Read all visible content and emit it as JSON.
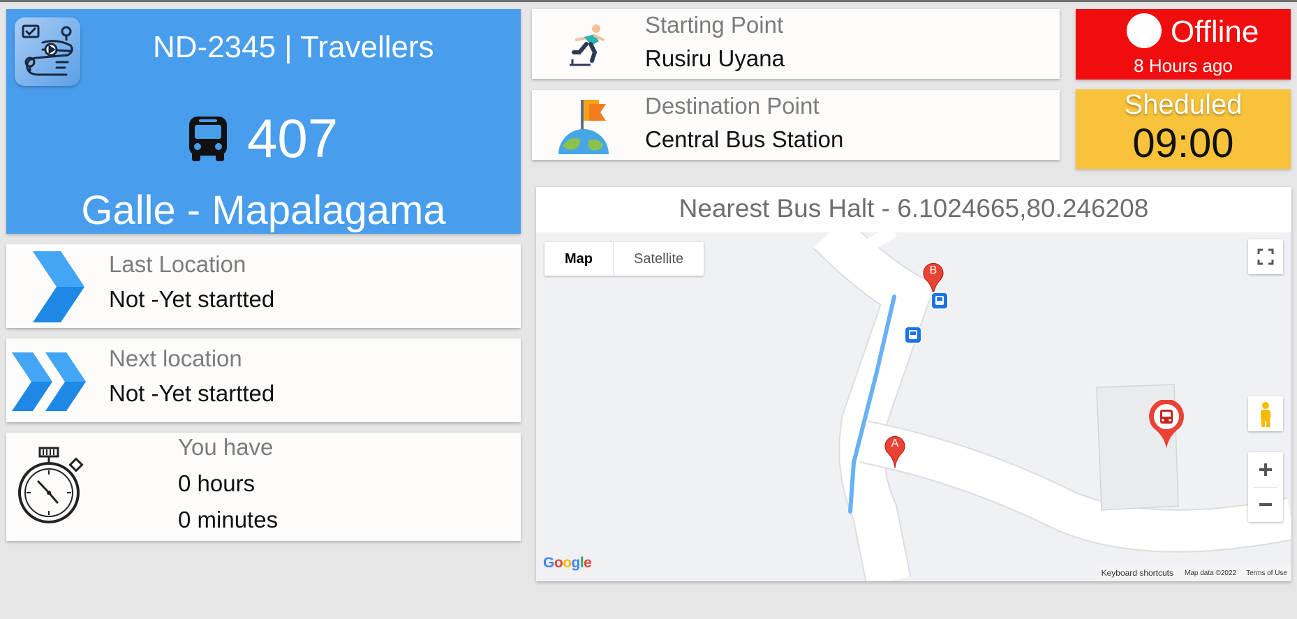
{
  "header": {
    "bus_code": "ND-2345 | Travellers",
    "route_number": "407",
    "route_name": "Galle - Mapalagama"
  },
  "start": {
    "label": "Starting Point",
    "value": "Rusiru Uyana"
  },
  "destination": {
    "label": "Destination Point",
    "value": "Central Bus Station"
  },
  "status": {
    "state": "Offline",
    "since": "8 Hours ago",
    "color": "#f10d0d"
  },
  "schedule": {
    "label": "Sheduled",
    "time": "09:00",
    "color": "#f8c33a"
  },
  "last_location": {
    "label": "Last Location",
    "value": "Not -Yet startted"
  },
  "next_location": {
    "label": "Next location",
    "value": "Not -Yet startted"
  },
  "time_left": {
    "label": "You have",
    "hours": "0 hours",
    "minutes": "0 minutes"
  },
  "map": {
    "title": "Nearest Bus Halt - 6.1024665,80.246208",
    "map_type_options": [
      "Map",
      "Satellite"
    ],
    "selected_map_type": "Map",
    "marker_a": "A",
    "marker_b": "B",
    "footer": {
      "shortcuts": "Keyboard shortcuts",
      "map_data": "Map data ©2022",
      "terms": "Terms of Use"
    },
    "icons": [
      "fullscreen-icon",
      "pegman-icon",
      "zoom-in-icon",
      "zoom-out-icon",
      "bus-stop-icon",
      "bus-halt-marker-icon"
    ]
  },
  "accent": {
    "primary_blue": "#489dec",
    "route_line": "#6ab0f5"
  }
}
